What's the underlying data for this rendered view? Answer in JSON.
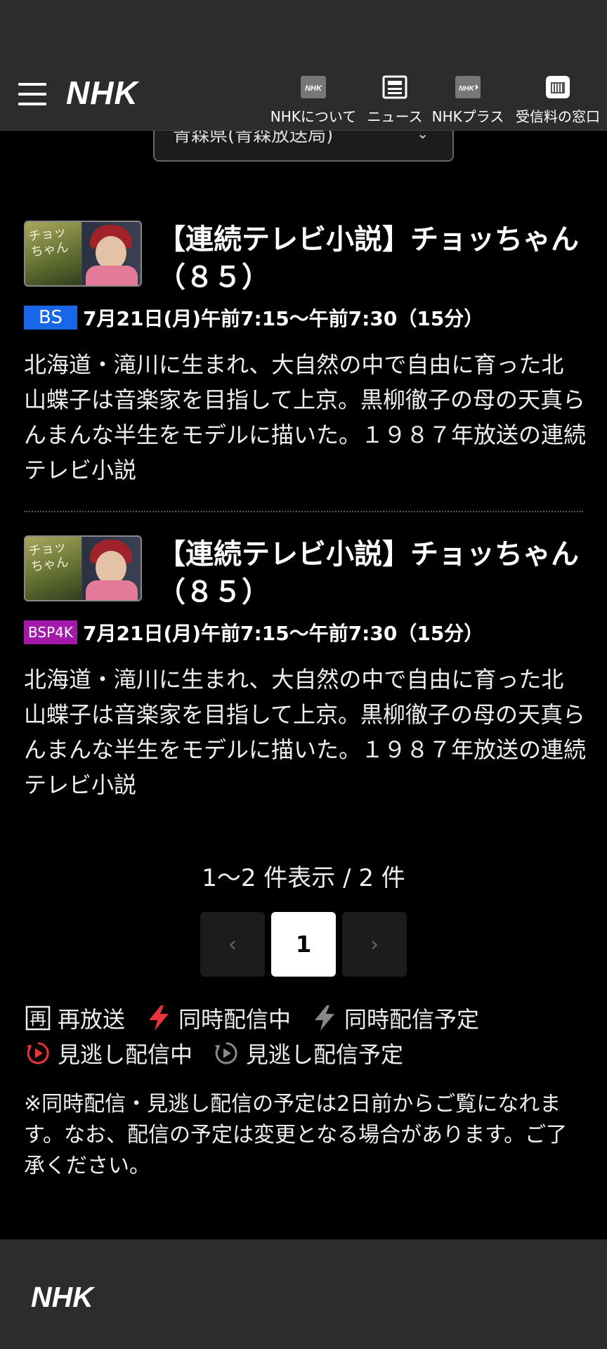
{
  "header": {
    "logo_text": "NHK",
    "nav": [
      {
        "label": "NHKについて",
        "icon": "nhk-badge-icon"
      },
      {
        "label": "ニュース",
        "icon": "newspaper-icon"
      },
      {
        "label": "NHKプラス",
        "icon": "nhk-plus-icon"
      },
      {
        "label": "受信料の窓口",
        "icon": "window-icon"
      }
    ]
  },
  "region_select": {
    "value": "青森県(青森放送局)"
  },
  "programs": [
    {
      "title": "【連続テレビ小説】チョッちゃん（８５）",
      "channel": "BS",
      "datetime": "7月21日(月)午前7:15〜午前7:30（15分）",
      "description": "北海道・滝川に生まれ、大自然の中で自由に育った北山蝶子は音楽家を目指して上京。黒柳徹子の母の天真らんまんな半生をモデルに描いた。１９８７年放送の連続テレビ小説",
      "thumbnail_text": "チョッちゃん"
    },
    {
      "title": "【連続テレビ小説】チョッちゃん（８５）",
      "channel": "BSP4K",
      "datetime": "7月21日(月)午前7:15〜午前7:30（15分）",
      "description": "北海道・滝川に生まれ、大自然の中で自由に育った北山蝶子は音楽家を目指して上京。黒柳徹子の母の天真らんまんな半生をモデルに描いた。１９８７年放送の連続テレビ小説",
      "thumbnail_text": "チョッちゃん"
    }
  ],
  "pagination": {
    "count_text": "1〜2 件表示 / 2 件",
    "prev": "‹",
    "current": "1",
    "next": "›"
  },
  "legend": {
    "rerun": "再放送",
    "rerun_icon_char": "再",
    "simul_now": "同時配信中",
    "simul_planned": "同時配信予定",
    "catchup_now": "見逃し配信中",
    "catchup_planned": "見逃し配信予定"
  },
  "note": "※同時配信・見逃し配信の予定は2日前からご覧になれます。なお、配信の予定は変更となる場合があります。ご了承ください。",
  "footer": {
    "logo_text": "NHK"
  },
  "colors": {
    "bs": "#1767e8",
    "bsp4k": "#a21aa9",
    "accent_red": "#e8333a",
    "background": "#000000",
    "header_bg": "#2c2c2e"
  }
}
